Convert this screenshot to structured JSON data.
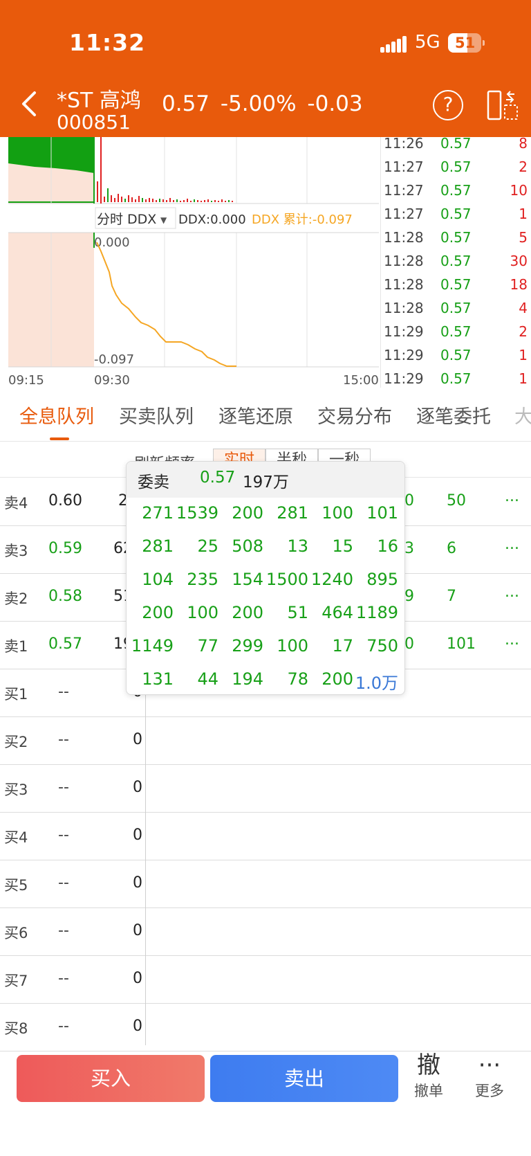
{
  "status_bar": {
    "time": "11:32",
    "network": "5G",
    "battery": "51"
  },
  "header": {
    "stock_name": "*ST 高鸿",
    "stock_code": "000851",
    "price": "0.57",
    "change_pct": "-5.00%",
    "change": "-0.03"
  },
  "chart": {
    "time_start": "09:15",
    "time_open": "09:30",
    "time_end": "15:00",
    "indicator_selector": "分时 DDX",
    "ddx_label": "DDX:0.000",
    "ddx_cum_label": "DDX 累计:-0.097",
    "ddx_top": "0.000",
    "ddx_bottom": "-0.097",
    "colors": {
      "ddx_line": "#f5a623",
      "volume_up": "#e02020",
      "volume_down": "#18a018",
      "preopen_bg": "#fbe3d7"
    }
  },
  "ticks": [
    {
      "time": "11:26",
      "price": "0.57",
      "vol": "8"
    },
    {
      "time": "11:27",
      "price": "0.57",
      "vol": "2"
    },
    {
      "time": "11:27",
      "price": "0.57",
      "vol": "10"
    },
    {
      "time": "11:27",
      "price": "0.57",
      "vol": "1"
    },
    {
      "time": "11:28",
      "price": "0.57",
      "vol": "5"
    },
    {
      "time": "11:28",
      "price": "0.57",
      "vol": "30"
    },
    {
      "time": "11:28",
      "price": "0.57",
      "vol": "18"
    },
    {
      "time": "11:28",
      "price": "0.57",
      "vol": "4"
    },
    {
      "time": "11:29",
      "price": "0.57",
      "vol": "2"
    },
    {
      "time": "11:29",
      "price": "0.57",
      "vol": "1"
    },
    {
      "time": "11:29",
      "price": "0.57",
      "vol": "1"
    }
  ],
  "tabs": [
    "全息队列",
    "买卖队列",
    "逐笔还原",
    "交易分布",
    "逐笔委托",
    "大"
  ],
  "refresh": {
    "label": "刷新频率",
    "options": [
      "实时",
      "半秒",
      "一秒"
    ]
  },
  "sell_rows": [
    {
      "label": "卖4",
      "price": "0.60",
      "vol": "2.1",
      "c1": "0",
      "c2": "50",
      "more": "..."
    },
    {
      "label": "卖3",
      "price": "0.59",
      "vol": "621",
      "c1": "3",
      "c2": "6",
      "more": "..."
    },
    {
      "label": "卖2",
      "price": "0.58",
      "vol": "513",
      "c1": "9",
      "c2": "7",
      "more": "..."
    },
    {
      "label": "卖1",
      "price": "0.57",
      "vol": "197",
      "c1": "0",
      "c2": "101",
      "more": "..."
    }
  ],
  "buy_rows": [
    {
      "label": "买1",
      "price": "--",
      "vol": "0"
    },
    {
      "label": "买2",
      "price": "--",
      "vol": "0"
    },
    {
      "label": "买3",
      "price": "--",
      "vol": "0"
    },
    {
      "label": "买4",
      "price": "--",
      "vol": "0"
    },
    {
      "label": "买5",
      "price": "--",
      "vol": "0"
    },
    {
      "label": "买6",
      "price": "--",
      "vol": "0"
    },
    {
      "label": "买7",
      "price": "--",
      "vol": "0"
    },
    {
      "label": "买8",
      "price": "--",
      "vol": "0"
    }
  ],
  "popup": {
    "title": "委卖",
    "price": "0.57",
    "volume": "197万",
    "cells": [
      [
        "271",
        "1539",
        "200",
        "281",
        "100",
        "101"
      ],
      [
        "281",
        "25",
        "508",
        "13",
        "15",
        "16"
      ],
      [
        "104",
        "235",
        "154",
        "1500",
        "1240",
        "895"
      ],
      [
        "200",
        "100",
        "200",
        "51",
        "464",
        "1189"
      ],
      [
        "1149",
        "77",
        "299",
        "100",
        "17",
        "750"
      ],
      [
        "131",
        "44",
        "194",
        "78",
        "200",
        "1.0万"
      ]
    ]
  },
  "bottom_bar": {
    "buy": "买入",
    "sell": "卖出",
    "cancel_icon": "撤",
    "cancel_label": "撤单",
    "more_icon": "···",
    "more_label": "更多"
  }
}
